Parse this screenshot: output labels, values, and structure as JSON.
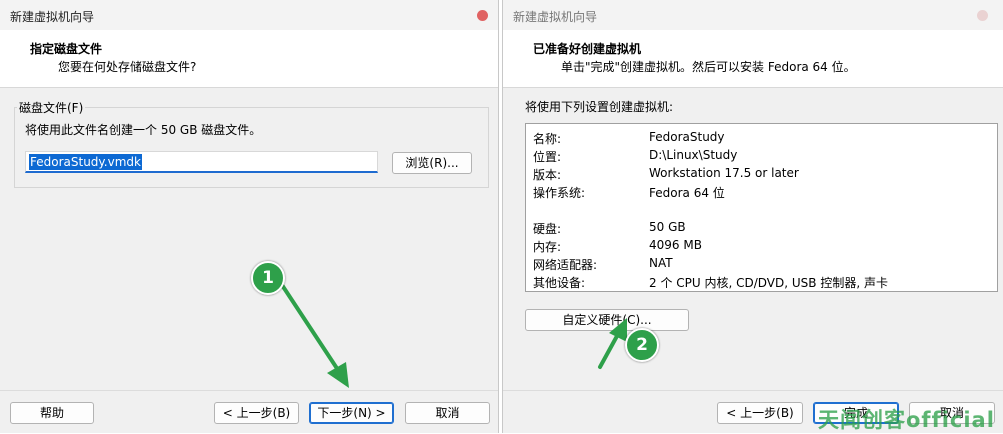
{
  "left_window": {
    "title": "新建虚拟机向导",
    "header_title": "指定磁盘文件",
    "header_subtitle": "您要在何处存储磁盘文件?",
    "group_label": "磁盘文件(F)",
    "description": "将使用此文件名创建一个 50 GB 磁盘文件。",
    "filename_value": "FedoraStudy.vmdk",
    "browse_label": "浏览(R)...",
    "help_label": "帮助",
    "back_label": "< 上一步(B)",
    "next_label": "下一步(N) >",
    "cancel_label": "取消"
  },
  "right_window": {
    "title": "新建虚拟机向导",
    "header_title": "已准备好创建虚拟机",
    "header_subtitle": "单击\"完成\"创建虚拟机。然后可以安装 Fedora 64 位。",
    "summary_intro": "将使用下列设置创建虚拟机:",
    "summary_rows": [
      {
        "label": "名称:",
        "value": "FedoraStudy"
      },
      {
        "label": "位置:",
        "value": "D:\\Linux\\Study"
      },
      {
        "label": "版本:",
        "value": "Workstation 17.5 or later"
      },
      {
        "label": "操作系统:",
        "value": "Fedora 64 位"
      },
      {
        "label": "硬盘:",
        "value": "50 GB"
      },
      {
        "label": "内存:",
        "value": "4096 MB"
      },
      {
        "label": "网络适配器:",
        "value": "NAT"
      },
      {
        "label": "其他设备:",
        "value": "2 个 CPU 内核, CD/DVD, USB 控制器, 声卡"
      }
    ],
    "customize_label": "自定义硬件(C)...",
    "back_label": "< 上一步(B)",
    "finish_label": "完成",
    "cancel_label": "取消"
  },
  "annotations": {
    "step1": "1",
    "step2": "2",
    "arrow_color": "#2ea04a"
  },
  "watermark": "天闻创客official"
}
